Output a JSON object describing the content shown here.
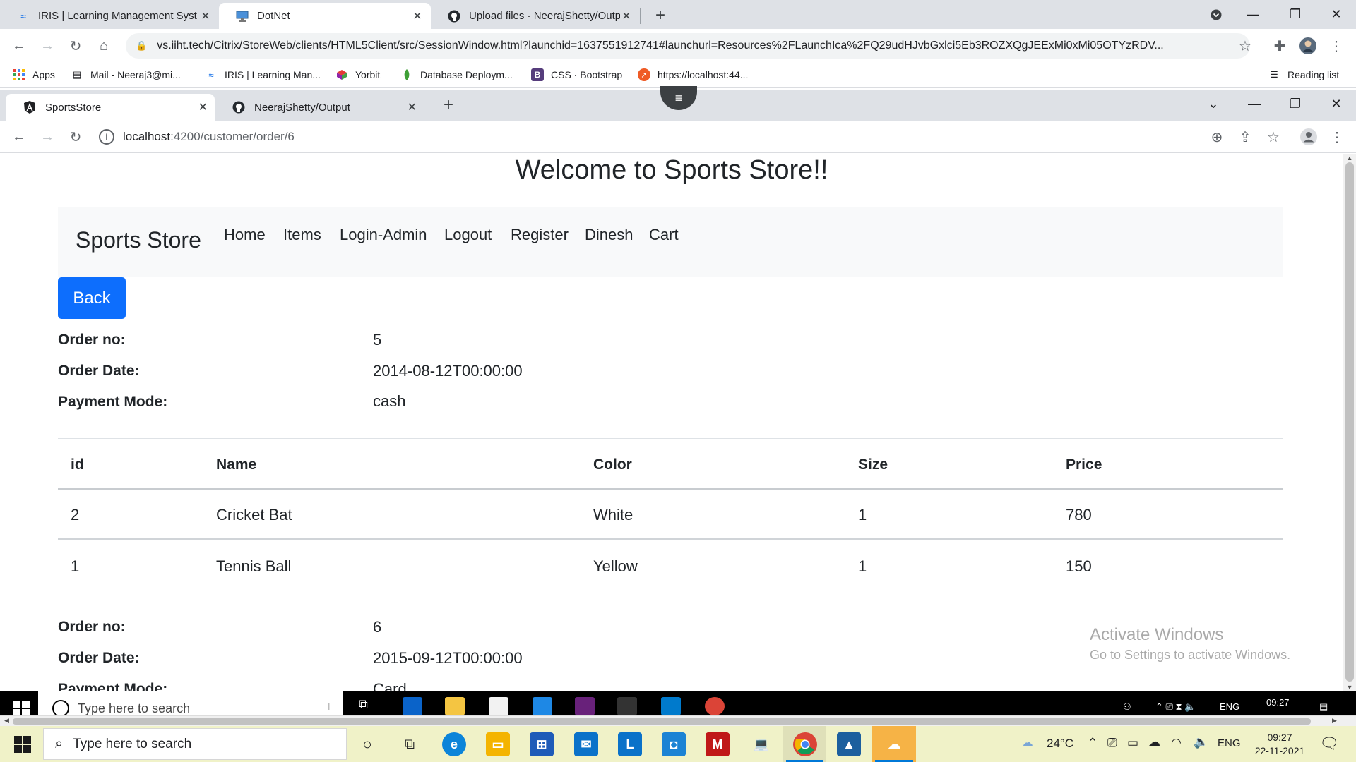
{
  "outer_browser": {
    "tabs": [
      {
        "label": "IRIS | Learning Management Syst",
        "icon": "iris-icon"
      },
      {
        "label": "DotNet",
        "icon": "monitor-icon"
      },
      {
        "label": "Upload files · NeerajShetty/Outp",
        "icon": "github-icon"
      }
    ],
    "url": "vs.iiht.tech/Citrix/StoreWeb/clients/HTML5Client/src/SessionWindow.html?launchid=1637551912741#launchurl=Resources%2FLaunchIca%2FQ29udHJvbGxlci5Eb3ROZXQgJEExMi0xMi05OTYzRDV...",
    "bookmarks": [
      "Apps",
      "Mail - Neeraj3@mi...",
      "IRIS | Learning Man...",
      "Yorbit",
      "Database Deploym...",
      "CSS · Bootstrap",
      "https://localhost:44..."
    ],
    "reading_list": "Reading list"
  },
  "inner_browser": {
    "tabs": [
      {
        "label": "SportsStore",
        "icon": "angular-icon"
      },
      {
        "label": "NeerajShetty/Output",
        "icon": "github-icon"
      }
    ],
    "url_host": "localhost",
    "url_path": ":4200/customer/order/6"
  },
  "page": {
    "title": "Welcome to Sports Store!!",
    "brand": "Sports Store",
    "nav": [
      "Home",
      "Items",
      "Login-Admin",
      "Logout",
      "Register",
      "Dinesh",
      "Cart"
    ],
    "back_label": "Back",
    "labels": {
      "order_no": "Order no:",
      "order_date": "Order Date:",
      "payment_mode": "Payment Mode:"
    },
    "table_headers": [
      "id",
      "Name",
      "Color",
      "Size",
      "Price"
    ],
    "orders": [
      {
        "order_no": "5",
        "order_date": "2014-08-12T00:00:00",
        "payment_mode": "cash",
        "items": [
          {
            "id": "2",
            "name": "Cricket Bat",
            "color": "White",
            "size": "1",
            "price": "780"
          },
          {
            "id": "1",
            "name": "Tennis Ball",
            "color": "Yellow",
            "size": "1",
            "price": "150"
          }
        ]
      },
      {
        "order_no": "6",
        "order_date": "2015-09-12T00:00:00",
        "payment_mode": "Card"
      }
    ],
    "watermark_title": "Activate Windows",
    "watermark_sub": "Go to Settings to activate Windows."
  },
  "inner_taskbar": {
    "search_placeholder": "Type here to search",
    "clock": "09:27",
    "lang": "ENG"
  },
  "taskbar": {
    "search_placeholder": "Type here to search",
    "weather": "24°C",
    "lang": "ENG",
    "time": "09:27",
    "date": "22-11-2021"
  },
  "colors": {
    "primary_button": "#0d6efd",
    "navbar_bg": "#f8f9fa",
    "taskbar_bg": "#f0f2c8"
  }
}
